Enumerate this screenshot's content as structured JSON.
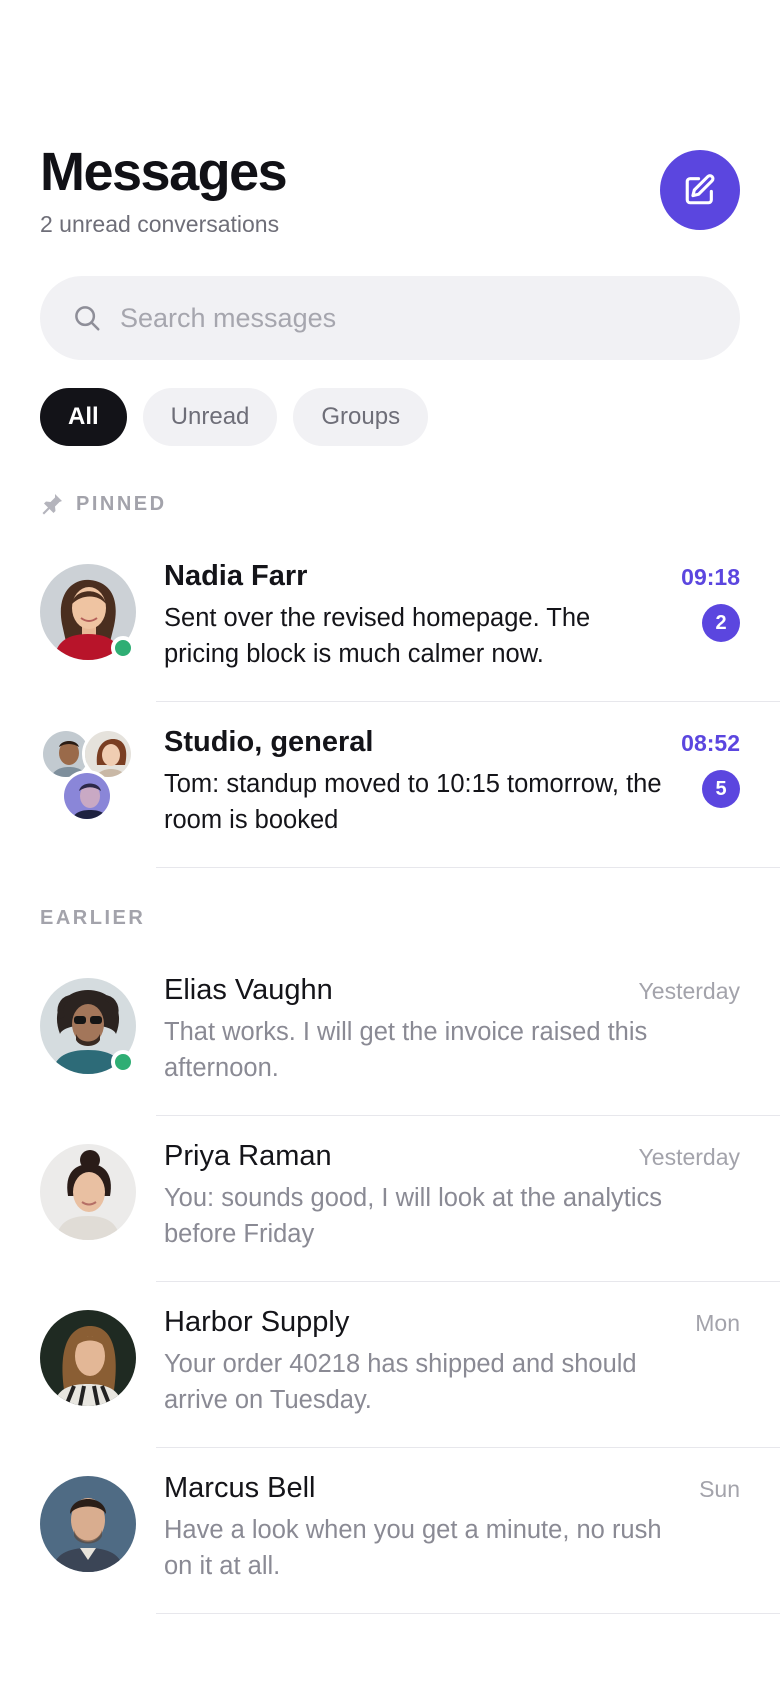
{
  "header": {
    "title": "Messages",
    "subtitle": "2 unread conversations",
    "compose_icon": "compose-icon"
  },
  "search": {
    "placeholder": "Search messages",
    "icon": "search-icon"
  },
  "filters": [
    {
      "label": "All",
      "active": true
    },
    {
      "label": "Unread",
      "active": false
    },
    {
      "label": "Groups",
      "active": false
    }
  ],
  "sections": {
    "pinned_label": "PINNED",
    "earlier_label": "EARLIER"
  },
  "pinned": [
    {
      "name": "Nadia Farr",
      "preview": "Sent over the revised homepage. The pricing block is much calmer now.",
      "time": "09:18",
      "unread_count": "2",
      "online": true
    },
    {
      "name": "Studio, general",
      "preview": "Tom: standup moved to 10:15 tomorrow, the room is booked",
      "time": "08:52",
      "unread_count": "5",
      "online": false
    }
  ],
  "earlier": [
    {
      "name": "Elias Vaughn",
      "preview": "That works. I will get the invoice raised this afternoon.",
      "time": "Yesterday",
      "online": true
    },
    {
      "name": "Priya Raman",
      "preview": "You: sounds good, I will look at the analytics before Friday",
      "time": "Yesterday",
      "online": false
    },
    {
      "name": "Harbor Supply",
      "preview": "Your order 40218 has shipped and should arrive on Tuesday.",
      "time": "Mon",
      "online": false
    },
    {
      "name": "Marcus Bell",
      "preview": "Have a look when you get a minute, no rush on it at all.",
      "time": "Sun",
      "online": false
    }
  ],
  "colors": {
    "accent": "#5b46df",
    "online": "#2fae74",
    "chip_active_bg": "#131318",
    "chip_bg": "#f1f1f4",
    "muted_text": "#8a8a94"
  }
}
